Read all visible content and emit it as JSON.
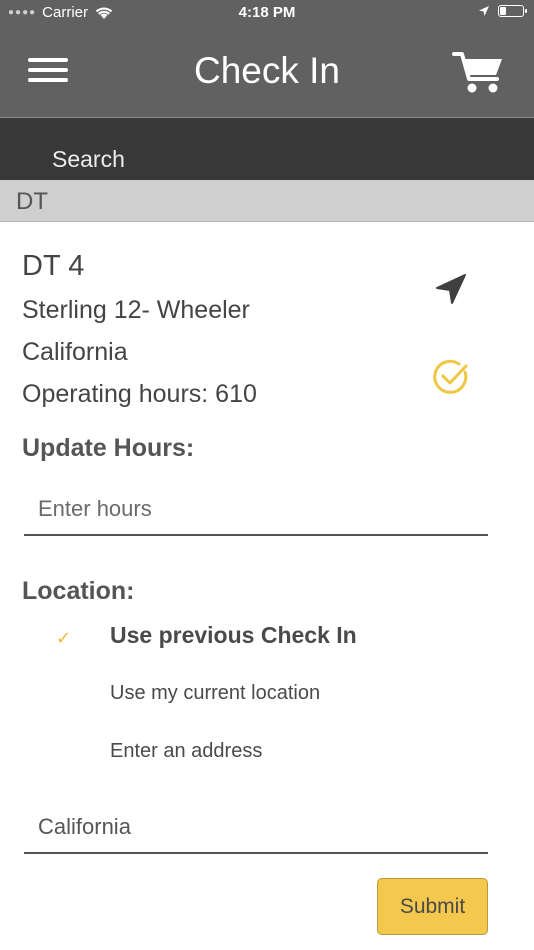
{
  "status_bar": {
    "carrier": "Carrier",
    "time": "4:18 PM"
  },
  "nav": {
    "title": "Check In",
    "menu_icon": "hamburger-icon",
    "cart_icon": "cart-icon"
  },
  "search": {
    "label": "Search"
  },
  "section": {
    "header": "DT"
  },
  "asset": {
    "name": "DT 4",
    "model": "Sterling 12- Wheeler",
    "location": "California",
    "operating_hours": "Operating hours: 610",
    "navigate_icon": "location-arrow-icon",
    "status_icon": "check-circle-icon"
  },
  "update_hours": {
    "label": "Update Hours:",
    "placeholder": "Enter hours",
    "value": ""
  },
  "location": {
    "label": "Location:",
    "options": [
      {
        "label": "Use previous Check In",
        "selected": true
      },
      {
        "label": "Use my current location",
        "selected": false
      },
      {
        "label": "Enter an address",
        "selected": false
      }
    ],
    "address_value": "California"
  },
  "submit": {
    "label": "Submit"
  },
  "colors": {
    "nav_bg": "#616161",
    "search_bg": "#383838",
    "section_bg": "#cfcfcf",
    "accent": "#f4c84d",
    "check": "#f0b53c"
  }
}
